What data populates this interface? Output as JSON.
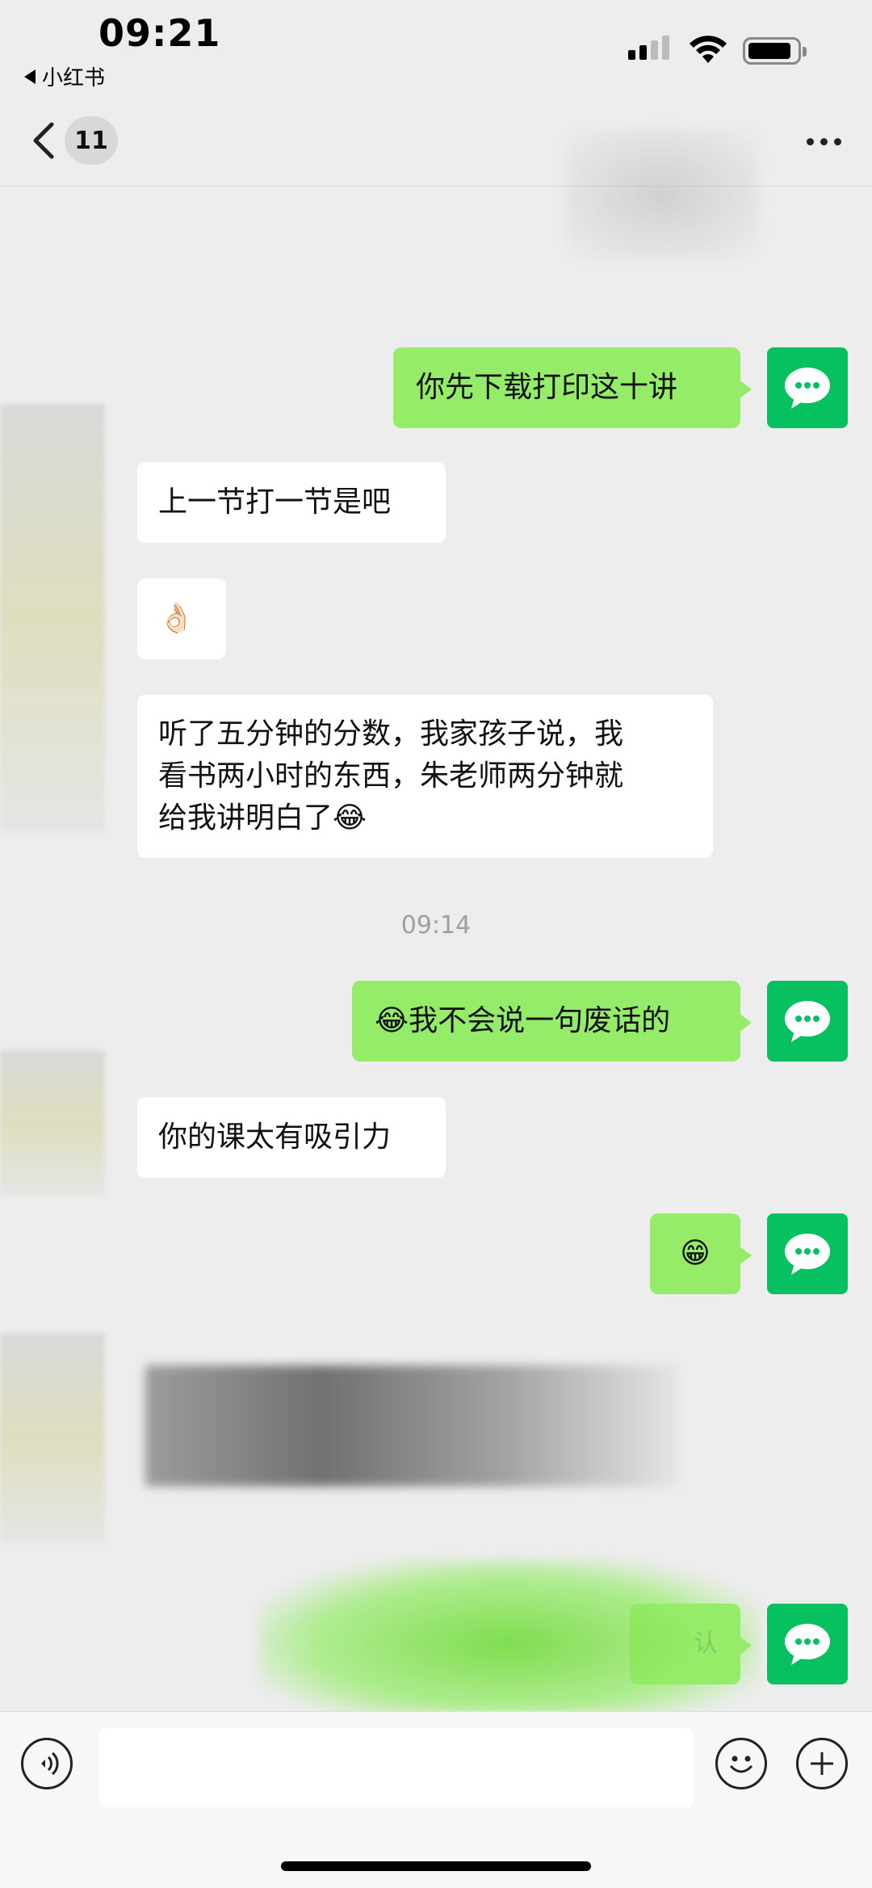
{
  "status_bar": {
    "time": "09:21",
    "back_app_label": "小红书"
  },
  "header": {
    "unread_count": "11"
  },
  "messages": [
    {
      "id": "m1",
      "side": "out",
      "text": "你先下载打印这十讲"
    },
    {
      "id": "m2",
      "side": "in",
      "text": "上一节打一节是吧"
    },
    {
      "id": "m3",
      "side": "in",
      "text": "👌🏻"
    },
    {
      "id": "m4",
      "side": "in",
      "lines": [
        "听了五分钟的分数，我家孩子说，我",
        "看书两小时的东西，朱老师两分钟就",
        "给我讲明白了😂"
      ]
    },
    {
      "id": "m5",
      "side": "out",
      "text": "😂我不会说一句废话的"
    },
    {
      "id": "m6",
      "side": "in",
      "text": "你的课太有吸引力"
    },
    {
      "id": "m7",
      "side": "out",
      "text": "😁"
    },
    {
      "id": "m8",
      "side": "out",
      "text": "认"
    }
  ],
  "timestamps": [
    "09:14"
  ],
  "input_bar": {
    "placeholder": ""
  },
  "icons": [
    "chevron-left-icon",
    "more-icon",
    "wechat-avatar-icon",
    "voice-icon",
    "emoji-icon",
    "plus-icon"
  ],
  "colors": {
    "background": "#ededed",
    "outgoing_bubble": "#95ec69",
    "incoming_bubble": "#ffffff",
    "avatar_green": "#07c160"
  }
}
